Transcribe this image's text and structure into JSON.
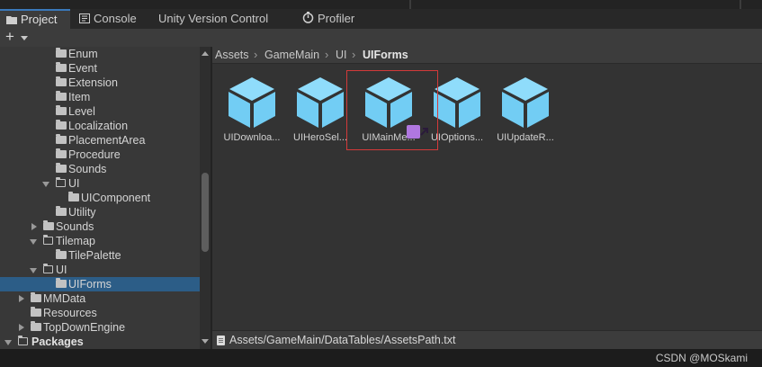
{
  "tabs": [
    {
      "label": "Project",
      "icon": "folder-icon",
      "active": true
    },
    {
      "label": "Console",
      "icon": "console-icon"
    },
    {
      "label": "Unity Version Control",
      "icon": null
    },
    {
      "label": "Profiler",
      "icon": "profiler-icon"
    }
  ],
  "toolbar": {
    "add_label": "+"
  },
  "tree": [
    {
      "label": "Enum"
    },
    {
      "label": "Event"
    },
    {
      "label": "Extension"
    },
    {
      "label": "Item"
    },
    {
      "label": "Level"
    },
    {
      "label": "Localization"
    },
    {
      "label": "PlacementArea"
    },
    {
      "label": "Procedure"
    },
    {
      "label": "Sounds"
    },
    {
      "label": "UI"
    },
    {
      "label": "UIComponent"
    },
    {
      "label": "Utility"
    },
    {
      "label": "Sounds"
    },
    {
      "label": "Tilemap"
    },
    {
      "label": "TilePalette"
    },
    {
      "label": "UI"
    },
    {
      "label": "UIForms",
      "selected": true
    },
    {
      "label": "MMData"
    },
    {
      "label": "Resources"
    },
    {
      "label": "TopDownEngine"
    },
    {
      "label": "Packages"
    }
  ],
  "breadcrumb": [
    "Assets",
    "GameMain",
    "UI",
    "UIForms"
  ],
  "assets": [
    {
      "label": "UIDownloa..."
    },
    {
      "label": "UIHeroSel..."
    },
    {
      "label": "UIMainMe..."
    },
    {
      "label": "UIOptions..."
    },
    {
      "label": "UIUpdateR..."
    }
  ],
  "status": {
    "path": "Assets/GameMain/DataTables/AssetsPath.txt"
  },
  "watermark": "CSDN @MOSkami",
  "colors": {
    "accent": "#3a79bb",
    "selection": "#2c5d87",
    "prefab": "#7fd0f5",
    "highlight_box": "#d33a3a",
    "link_badge": "#b077e0"
  }
}
